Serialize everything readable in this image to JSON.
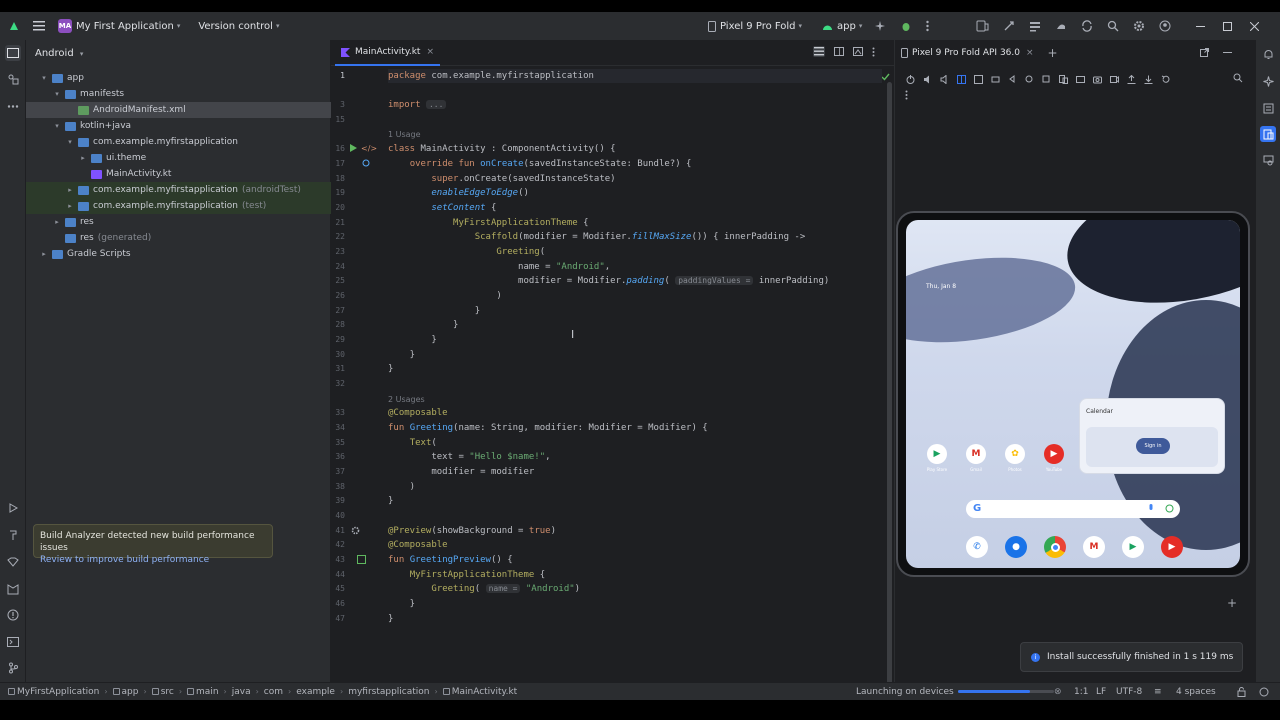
{
  "toolbar": {
    "project_badge": "MA",
    "project_name": "My First Application",
    "vcs": "Version control",
    "device": "Pixel 9 Pro Fold",
    "run_config": "app"
  },
  "project": {
    "view": "Android",
    "tree": [
      {
        "label": "app",
        "sub": "",
        "indent": 1,
        "arrow": "▾",
        "icon": "folder",
        "state": ""
      },
      {
        "label": "manifests",
        "sub": "",
        "indent": 2,
        "arrow": "▾",
        "icon": "folder",
        "state": ""
      },
      {
        "label": "AndroidManifest.xml",
        "sub": "",
        "indent": 3,
        "arrow": "",
        "icon": "mf",
        "state": "sel"
      },
      {
        "label": "kotlin+java",
        "sub": "",
        "indent": 2,
        "arrow": "▾",
        "icon": "folder",
        "state": ""
      },
      {
        "label": "com.example.myfirstapplication",
        "sub": "",
        "indent": 3,
        "arrow": "▾",
        "icon": "folder",
        "state": ""
      },
      {
        "label": "ui.theme",
        "sub": "",
        "indent": 4,
        "arrow": "▸",
        "icon": "folder",
        "state": ""
      },
      {
        "label": "MainActivity.kt",
        "sub": "",
        "indent": 4,
        "arrow": "",
        "icon": "kt",
        "state": ""
      },
      {
        "label": "com.example.myfirstapplication",
        "sub": "(androidTest)",
        "indent": 3,
        "arrow": "▸",
        "icon": "folder",
        "state": "green"
      },
      {
        "label": "com.example.myfirstapplication",
        "sub": "(test)",
        "indent": 3,
        "arrow": "▸",
        "icon": "folder",
        "state": "green"
      },
      {
        "label": "res",
        "sub": "",
        "indent": 2,
        "arrow": "▸",
        "icon": "folder",
        "state": ""
      },
      {
        "label": "res",
        "sub": "(generated)",
        "indent": 2,
        "arrow": "",
        "icon": "folder",
        "state": ""
      },
      {
        "label": "Gradle Scripts",
        "sub": "",
        "indent": 1,
        "arrow": "▸",
        "icon": "folder",
        "state": ""
      }
    ]
  },
  "notification": {
    "title": "Build Analyzer detected new build performance issues",
    "link": "Review to improve build performance"
  },
  "editor": {
    "tab": "MainActivity.kt",
    "usage1": "1 Usage",
    "usage2": "2 Usages"
  },
  "emulator": {
    "tab": "Pixel 9 Pro Fold API 36.0",
    "date": "Thu, Jan 8",
    "widget_title": "Calendar",
    "widget_button": "Sign in",
    "apps": [
      "Play Store",
      "Gmail",
      "Photos",
      "YouTube"
    ]
  },
  "toast": "Install successfully finished in 1 s 119 ms",
  "status": {
    "breadcrumbs": [
      "MyFirstApplication",
      "app",
      "src",
      "main",
      "java",
      "com",
      "example",
      "myfirstapplication",
      "MainActivity.kt"
    ],
    "task": "Launching on devices",
    "progress": 0.75,
    "position": "1:1",
    "line_sep": "LF",
    "encoding": "UTF-8",
    "indent": "4 spaces"
  }
}
